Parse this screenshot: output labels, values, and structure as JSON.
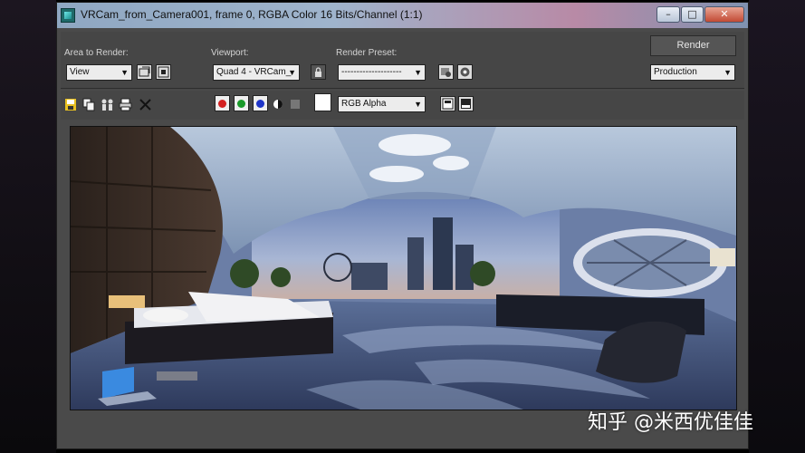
{
  "window": {
    "title": "VRCam_from_Camera001, frame 0, RGBA Color 16 Bits/Channel (1:1)",
    "controls": {
      "minimize": "–",
      "maximize": "□",
      "close": "✕"
    }
  },
  "toolbar": {
    "area_to_render_label": "Area to Render:",
    "area_to_render_value": "View",
    "viewport_label": "Viewport:",
    "viewport_value": "Quad 4 - VRCam_",
    "render_preset_label": "Render Preset:",
    "render_preset_value": "--------------------",
    "render_button": "Render",
    "production_value": "Production"
  },
  "toolbar2": {
    "channel_value": "RGB Alpha",
    "channels": [
      {
        "name": "red",
        "color": "#d42020"
      },
      {
        "name": "green",
        "color": "#1a9a2a"
      },
      {
        "name": "blue",
        "color": "#1f35c8"
      }
    ]
  },
  "watermark": "知乎 @米西优佳佳"
}
